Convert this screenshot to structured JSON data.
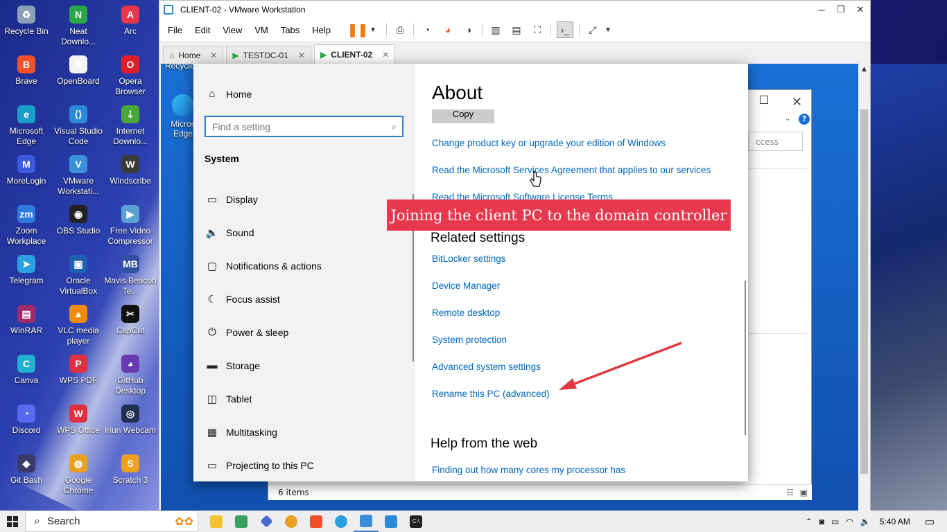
{
  "desktop": {
    "icons": [
      {
        "label": "Recycle Bin",
        "glyph": "♻",
        "color": "#8aa0b8"
      },
      {
        "label": "Neat Downlo...",
        "glyph": "N",
        "color": "#2aa84a"
      },
      {
        "label": "Arc",
        "glyph": "A",
        "color": "#e8364a"
      },
      {
        "label": "Brave",
        "glyph": "B",
        "color": "#f0502a"
      },
      {
        "label": "OpenBoard",
        "glyph": "✎",
        "color": "#f4f4f4"
      },
      {
        "label": "Opera Browser",
        "glyph": "O",
        "color": "#e01e2a"
      },
      {
        "label": "Microsoft Edge",
        "glyph": "e",
        "color": "#1aa0c8"
      },
      {
        "label": "Visual Studio Code",
        "glyph": "⟨⟩",
        "color": "#2a8ad8"
      },
      {
        "label": "Internet Downlo...",
        "glyph": "⇣",
        "color": "#4aa83a"
      },
      {
        "label": "MoreLogin",
        "glyph": "M",
        "color": "#3a5ae0"
      },
      {
        "label": "VMware Workstati...",
        "glyph": "V",
        "color": "#3a90d8"
      },
      {
        "label": "Windscribe",
        "glyph": "W",
        "color": "#3a3a3a"
      },
      {
        "label": "Zoom Workplace",
        "glyph": "zm",
        "color": "#2a7ae0"
      },
      {
        "label": "OBS Studio",
        "glyph": "◉",
        "color": "#222"
      },
      {
        "label": "Free Video Compressor",
        "glyph": "▶",
        "color": "#5aa0d0"
      },
      {
        "label": "Telegram",
        "glyph": "➤",
        "color": "#2aa0e0"
      },
      {
        "label": "Oracle VirtualBox",
        "glyph": "▣",
        "color": "#2060b0"
      },
      {
        "label": "Mavis Beacon Te...",
        "glyph": "MB",
        "color": "#3050a0"
      },
      {
        "label": "WinRAR",
        "glyph": "▤",
        "color": "#a02a6a"
      },
      {
        "label": "VLC media player",
        "glyph": "▲",
        "color": "#f08a10"
      },
      {
        "label": "CapCut",
        "glyph": "✂",
        "color": "#111"
      },
      {
        "label": "Canva",
        "glyph": "C",
        "color": "#20b0d0"
      },
      {
        "label": "WPS PDF",
        "glyph": "P",
        "color": "#e03040"
      },
      {
        "label": "GitHub Desktop",
        "glyph": "◕",
        "color": "#6a3ab0"
      },
      {
        "label": "Discord",
        "glyph": "◔",
        "color": "#5a6af0"
      },
      {
        "label": "WPS Office",
        "glyph": "W",
        "color": "#e03040"
      },
      {
        "label": "Iriun Webcam",
        "glyph": "◎",
        "color": "#203050"
      },
      {
        "label": "Git Bash",
        "glyph": "◆",
        "color": "#3a3a6a"
      },
      {
        "label": "Google Chrome",
        "glyph": "◍",
        "color": "#e8a020"
      },
      {
        "label": "Scratch 3",
        "glyph": "S",
        "color": "#f0a020"
      }
    ],
    "guest_icons": [
      {
        "label": "Recycle"
      },
      {
        "label": "Micros Edge"
      }
    ]
  },
  "vmware": {
    "title": "CLIENT-02 - VMware Workstation",
    "menu": [
      "File",
      "Edit",
      "View",
      "VM",
      "Tabs",
      "Help"
    ],
    "tabs": [
      {
        "label": "Home",
        "icon": "⌂"
      },
      {
        "label": "TESTDC-01",
        "icon": "▶"
      },
      {
        "label": "CLIENT-02",
        "icon": "▶"
      }
    ]
  },
  "settings": {
    "home": "Home",
    "search_placeholder": "Find a setting",
    "section": "System",
    "nav": [
      {
        "label": "Display",
        "icon": "▭"
      },
      {
        "label": "Sound",
        "icon": "🔈"
      },
      {
        "label": "Notifications & actions",
        "icon": "▢"
      },
      {
        "label": "Focus assist",
        "icon": "☾"
      },
      {
        "label": "Power & sleep",
        "icon": "⏻"
      },
      {
        "label": "Storage",
        "icon": "▬"
      },
      {
        "label": "Tablet",
        "icon": "◫"
      },
      {
        "label": "Multitasking",
        "icon": "▦"
      },
      {
        "label": "Projecting to this PC",
        "icon": "▭"
      }
    ],
    "about_title": "About",
    "copy_button": "Copy",
    "links_top": [
      "Change product key or upgrade your edition of Windows",
      "Read the Microsoft Services Agreement that applies to our services",
      "Read the Microsoft Software License Terms"
    ],
    "related_heading": "Related settings",
    "related_links": [
      "BitLocker settings",
      "Device Manager",
      "Remote desktop",
      "System protection",
      "Advanced system settings",
      "Rename this PC (advanced)"
    ],
    "help_heading": "Help from the web",
    "help_links": [
      "Finding out how many cores my processor has"
    ]
  },
  "explorer": {
    "search_placeholder": "ccess",
    "status": "6 items"
  },
  "annotation": {
    "banner": "Joining the client PC to the domain controller",
    "banner_color": "#e8384e",
    "arrow_color": "#e0383e"
  },
  "taskbar": {
    "search_label": "Search",
    "time": "5:40 AM"
  }
}
